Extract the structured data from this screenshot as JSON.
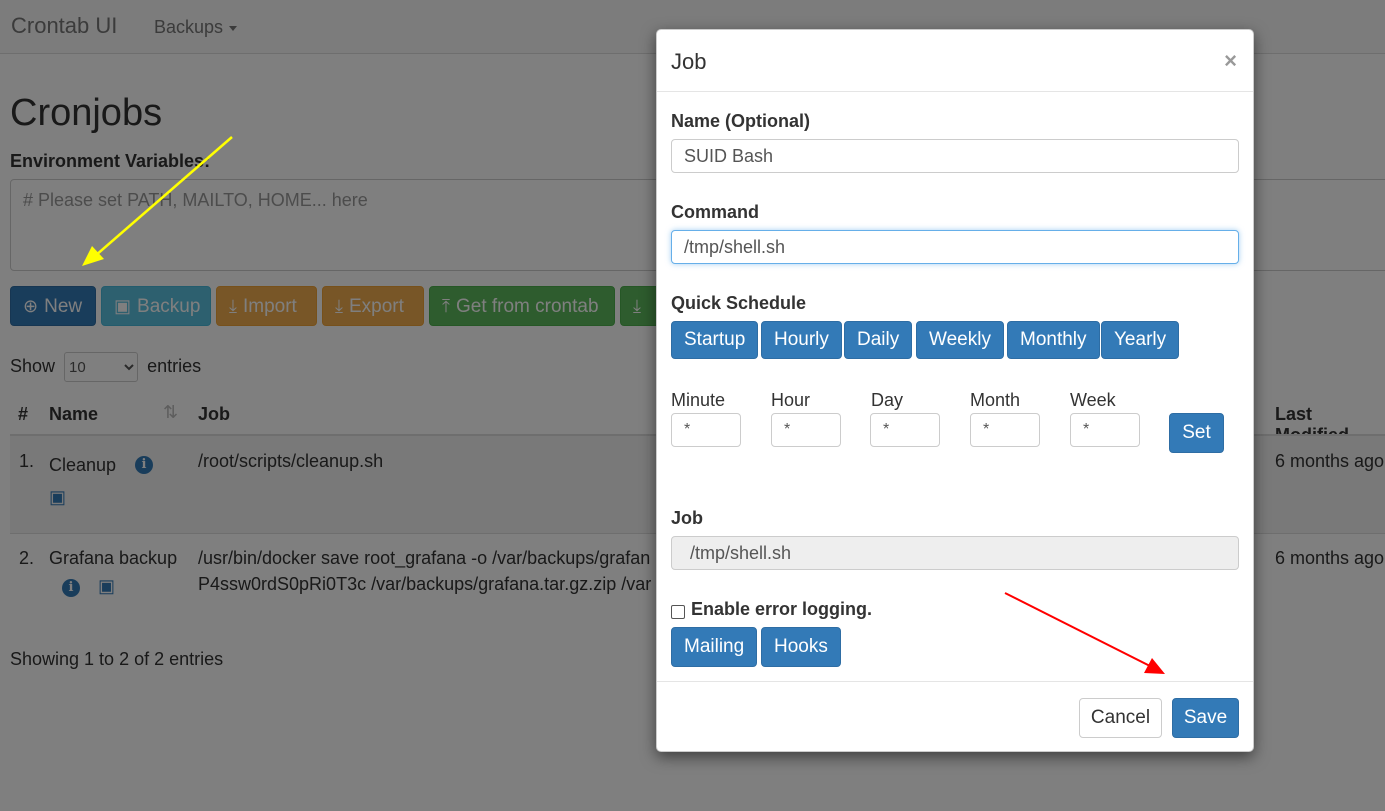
{
  "navbar": {
    "brand": "Crontab UI",
    "backups_label": "Backups"
  },
  "page": {
    "title": "Cronjobs",
    "env_label": "Environment Variables:",
    "env_placeholder": "# Please set PATH, MAILTO, HOME... here"
  },
  "toolbar": {
    "new": "New",
    "backup": "Backup",
    "import": "Import",
    "export": "Export",
    "get_from_crontab": "Get from crontab"
  },
  "table": {
    "show_label": "Show",
    "entries_label": "entries",
    "page_size": "10",
    "headers": {
      "num": "#",
      "name": "Name",
      "job": "Job",
      "last_modified": "Last Modified"
    },
    "rows": [
      {
        "num": "1.",
        "name": "Cleanup",
        "job": "/root/scripts/cleanup.sh",
        "job2": "",
        "modified": "6 months ago"
      },
      {
        "num": "2.",
        "name": "Grafana backup",
        "job": "/usr/bin/docker save root_grafana -o /var/backups/grafan",
        "job2": "P4ssw0rdS0pRi0T3c /var/backups/grafana.tar.gz.zip /var",
        "modified": "6 months ago"
      }
    ],
    "showing": "Showing 1 to 2 of 2 entries"
  },
  "modal": {
    "title": "Job",
    "close": "×",
    "name_label": "Name (Optional)",
    "name_value": "SUID Bash",
    "command_label": "Command",
    "command_value": "/tmp/shell.sh",
    "quick_label": "Quick Schedule",
    "quick": [
      "Startup",
      "Hourly",
      "Daily",
      "Weekly",
      "Monthly",
      "Yearly"
    ],
    "fields": [
      {
        "label": "Minute",
        "value": "*"
      },
      {
        "label": "Hour",
        "value": "*"
      },
      {
        "label": "Day",
        "value": "*"
      },
      {
        "label": "Month",
        "value": "*"
      },
      {
        "label": "Week",
        "value": "*"
      }
    ],
    "set": "Set",
    "job_label": "Job",
    "job_value": "/tmp/shell.sh",
    "error_logging": "Enable error logging.",
    "mailing": "Mailing",
    "hooks": "Hooks",
    "cancel": "Cancel",
    "save": "Save"
  },
  "colors": {
    "primary": "#337ab7",
    "info": "#5bc0de",
    "warning": "#f0ad4e",
    "success": "#5cb85c",
    "annotation_yellow": "#ffff00",
    "annotation_red": "#ff0000"
  }
}
